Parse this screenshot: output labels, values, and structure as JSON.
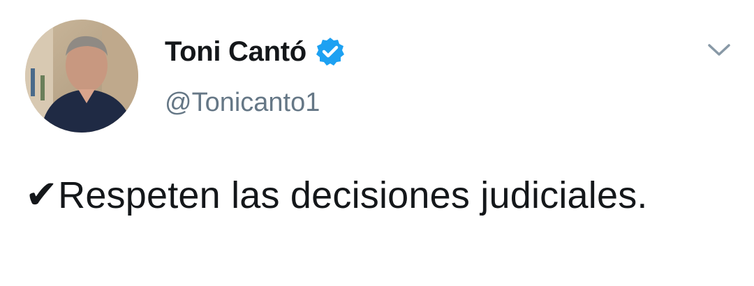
{
  "author": {
    "name": "Toni Cantó",
    "handle": "@Tonicanto1",
    "verified": true,
    "verified_color": "#1da1f2"
  },
  "tweet": {
    "prefix_icon": "heavy-check-mark-icon",
    "prefix_glyph": "✔",
    "text": "Respeten las decisiones judiciales."
  },
  "menu": {
    "icon": "chevron-down-icon"
  },
  "colors": {
    "text": "#14171a",
    "secondary": "#657786",
    "chevron": "#8899a6"
  }
}
